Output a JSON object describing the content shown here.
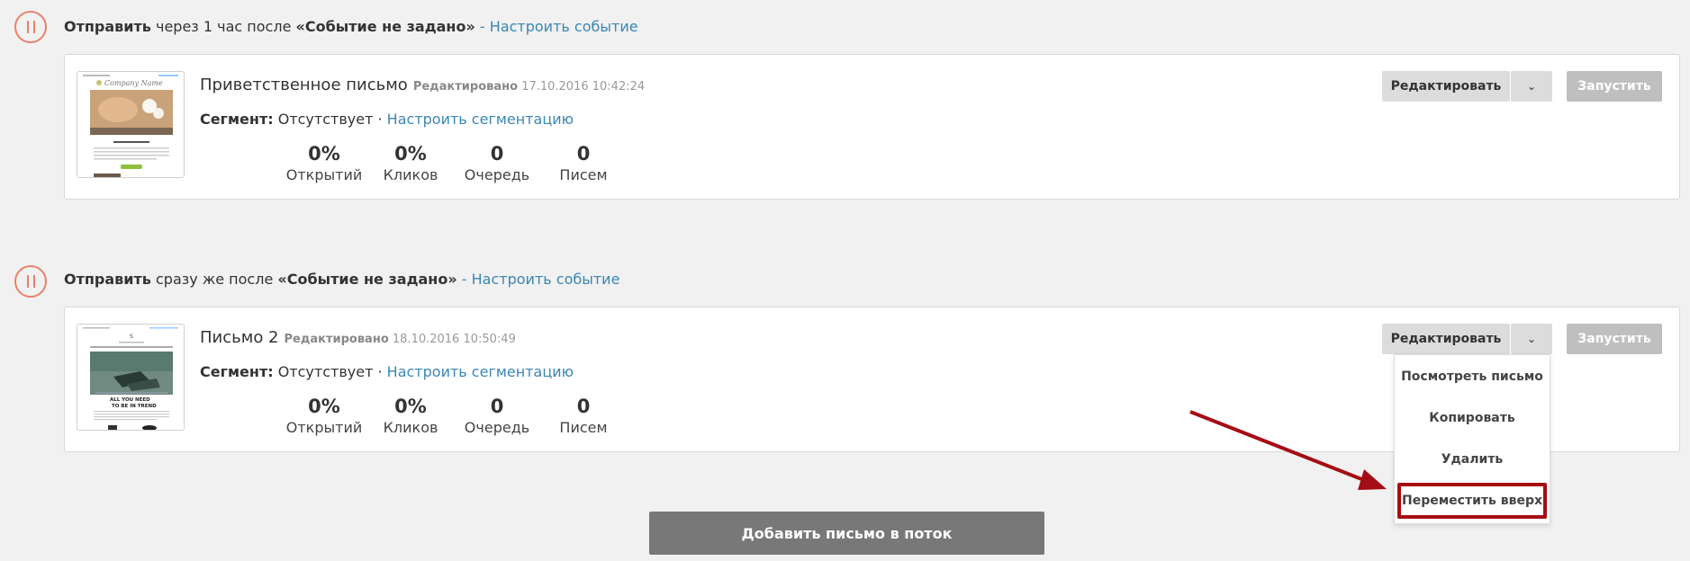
{
  "steps": [
    {
      "trigger": {
        "send_label": "Отправить",
        "delay": "через 1 час после",
        "event": "«Событие не задано»",
        "separator": "-",
        "configure_link": "Настроить событие"
      },
      "letter": {
        "title": "Приветственное письмо",
        "edited_label": "Редактировано",
        "edited_date": "17.10.2016 10:42:24",
        "segment_label": "Сегмент:",
        "segment_value": "Отсутствует",
        "segment_sep": "·",
        "segment_link": "Настроить сегментацию",
        "stats": [
          {
            "value": "0%",
            "label": "Открытий"
          },
          {
            "value": "0%",
            "label": "Кликов"
          },
          {
            "value": "0",
            "label": "Очередь"
          },
          {
            "value": "0",
            "label": "Писем"
          }
        ],
        "thumb_brand": "Company Name",
        "edit_button": "Редактировать",
        "run_button": "Запустить"
      }
    },
    {
      "trigger": {
        "send_label": "Отправить",
        "delay": "сразу же после",
        "event": "«Событие не задано»",
        "separator": "-",
        "configure_link": "Настроить событие"
      },
      "letter": {
        "title": "Письмо 2",
        "edited_label": "Редактировано",
        "edited_date": "18.10.2016 10:50:49",
        "segment_label": "Сегмент:",
        "segment_value": "Отсутствует",
        "segment_sep": "·",
        "segment_link": "Настроить сегментацию",
        "stats": [
          {
            "value": "0%",
            "label": "Открытий"
          },
          {
            "value": "0%",
            "label": "Кликов"
          },
          {
            "value": "0",
            "label": "Очередь"
          },
          {
            "value": "0",
            "label": "Писем"
          }
        ],
        "thumb_headline": "ALL YOU NEED\nTO BE IN TREND",
        "edit_button": "Редактировать",
        "run_button": "Запустить"
      }
    }
  ],
  "dropdown": {
    "items": [
      "Посмотреть письмо",
      "Копировать",
      "Удалить",
      "Переместить вверх"
    ]
  },
  "add_button": "Добавить письмо в поток",
  "colors": {
    "accent_link": "#3a86b3",
    "pause_icon": "#e8806c",
    "highlight": "#a50d14"
  }
}
